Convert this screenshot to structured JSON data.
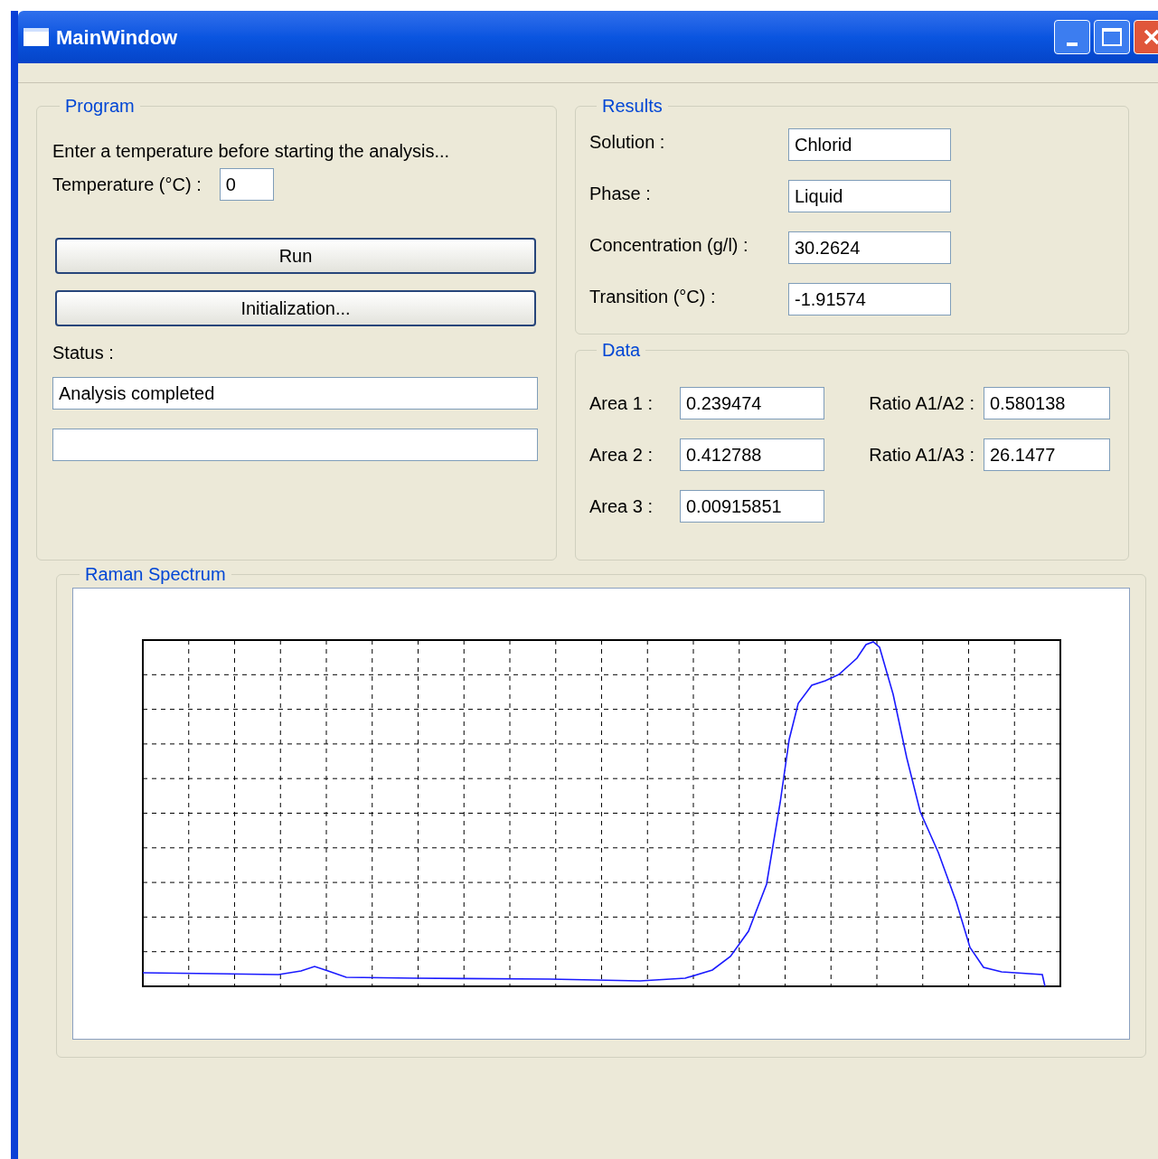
{
  "window": {
    "title": "MainWindow"
  },
  "program": {
    "title": "Program",
    "instruction": "Enter a temperature before starting the analysis...",
    "temperature": {
      "label": "Temperature (°C) :",
      "value": "0"
    },
    "buttons": [
      "Run",
      "Initialization..."
    ],
    "status": {
      "label": "Status :",
      "value": "Analysis completed"
    }
  },
  "results": {
    "title": "Results",
    "fields": [
      {
        "label": "Solution :",
        "value": "Chlorid"
      },
      {
        "label": "Phase :",
        "value": "Liquid"
      },
      {
        "label": "Concentration (g/l) :",
        "value": "30.2624"
      },
      {
        "label": "Transition (°C) :",
        "value": "-1.91574"
      }
    ]
  },
  "data": {
    "title": "Data",
    "fields": [
      {
        "label": "Area 1 :",
        "value": "0.239474"
      },
      {
        "label": "Ratio A1/A2 :",
        "value": "0.580138"
      },
      {
        "label": "Area 2 :",
        "value": "0.412788"
      },
      {
        "label": "Ratio A1/A3 :",
        "value": "26.1477"
      },
      {
        "label": "Area 3 :",
        "value": "0.00915851"
      }
    ]
  },
  "spectrum": {
    "title": "Raman Spectrum"
  }
}
